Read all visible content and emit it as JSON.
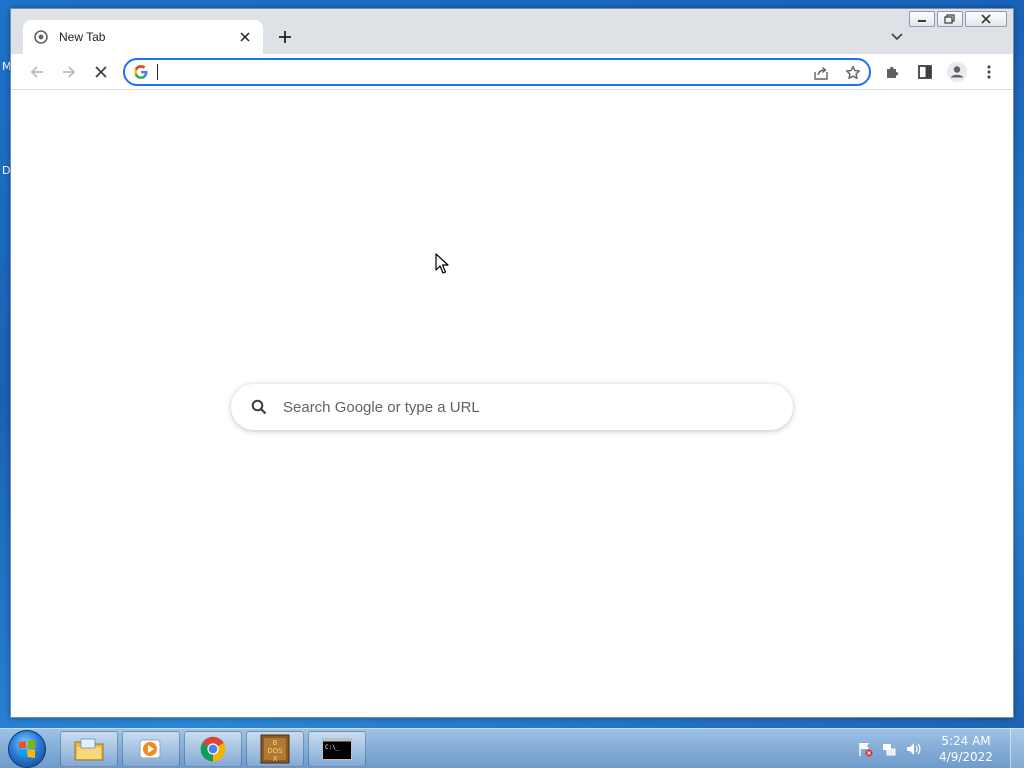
{
  "desktop": {
    "edge_label_top": "M",
    "edge_label_mid": "D"
  },
  "window": {
    "caption": {
      "minimize": "minimize",
      "maximize": "restore",
      "close": "close"
    }
  },
  "tabs": [
    {
      "title": "New Tab",
      "favicon": "chrome-newtab-icon"
    }
  ],
  "toolbar": {
    "back": "arrow-left-icon",
    "forward": "arrow-right-icon",
    "stop": "close-icon",
    "omnibox": {
      "value": "",
      "placeholder": ""
    },
    "icons": [
      "share-icon",
      "star-icon",
      "puzzle-icon",
      "side-panel-icon",
      "profile-icon",
      "kebab-menu-icon"
    ]
  },
  "ntp": {
    "search_placeholder": "Search Google or type a URL"
  },
  "taskbar": {
    "apps": [
      "file-explorer-icon",
      "media-player-icon",
      "chrome-icon",
      "dosbox-icon",
      "command-prompt-icon"
    ],
    "dosbox_label": "DOS BOX",
    "cmd_label": "C:\\_",
    "clock_time": "5:24 AM",
    "clock_date": "4/9/2022"
  },
  "colors": {
    "accent": "#1a73e8",
    "tab_bg": "#ffffff",
    "strip_bg": "#dee1e6"
  }
}
